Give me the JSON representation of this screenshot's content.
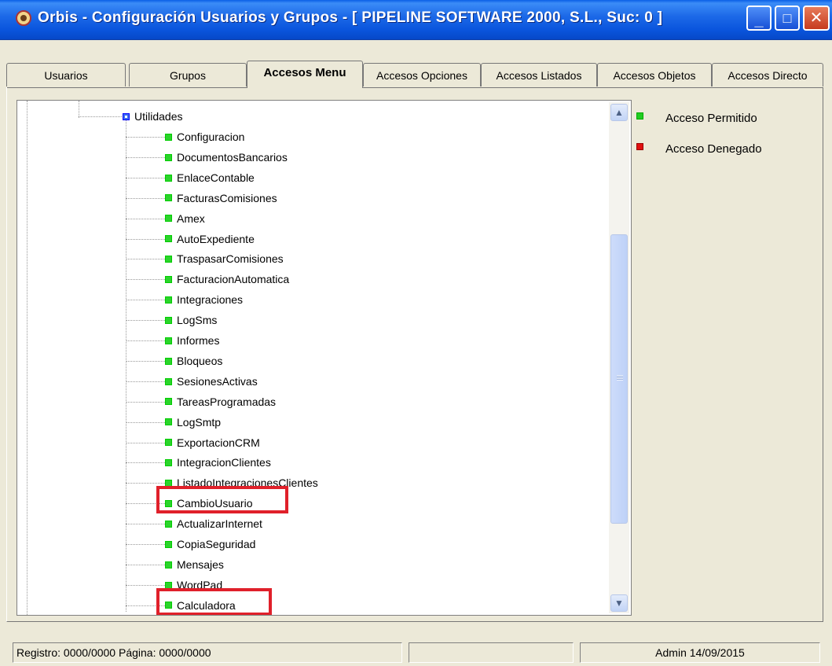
{
  "window": {
    "title": "Orbis - Configuración Usuarios y Grupos - [ PIPELINE SOFTWARE 2000, S.L.,  Suc: 0 ]",
    "icon": "orbis-app-icon"
  },
  "tabs": [
    {
      "label": "Usuarios",
      "active": false
    },
    {
      "label": "Grupos",
      "active": false
    },
    {
      "label": "Accesos Menu",
      "active": true
    },
    {
      "label": "Accesos Opciones",
      "active": false
    },
    {
      "label": "Accesos Listados",
      "active": false
    },
    {
      "label": "Accesos Objetos",
      "active": false
    },
    {
      "label": "Accesos Directo",
      "active": false
    }
  ],
  "tree": {
    "parent": {
      "label": "Utilidades",
      "icon": "expanded-node-icon"
    },
    "children": [
      "Configuracion",
      "DocumentosBancarios",
      "EnlaceContable",
      "FacturasComisiones",
      "Amex",
      "AutoExpediente",
      "TraspasarComisiones",
      "FacturacionAutomatica",
      "Integraciones",
      "LogSms",
      "Informes",
      "Bloqueos",
      "SesionesActivas",
      "TareasProgramadas",
      "LogSmtp",
      "ExportacionCRM",
      "IntegracionClientes",
      "ListadoIntegracionesClientes",
      "CambioUsuario",
      "ActualizarInternet",
      "CopiaSeguridad",
      "Mensajes",
      "WordPad",
      "Calculadora"
    ],
    "highlighted": [
      "CambioUsuario",
      "Calculadora"
    ]
  },
  "legend": {
    "allowed": {
      "label": "Acceso Permitido",
      "color": "#22cc22"
    },
    "denied": {
      "label": "Acceso Denegado",
      "color": "#e01010"
    }
  },
  "colors": {
    "highlight": "#e0202a",
    "titlebar": "#0a55dd"
  },
  "statusbar": {
    "record": "Registro: 0000/0000  Página: 0000/0000",
    "middle": "",
    "user_date": "Admin 14/09/2015"
  }
}
